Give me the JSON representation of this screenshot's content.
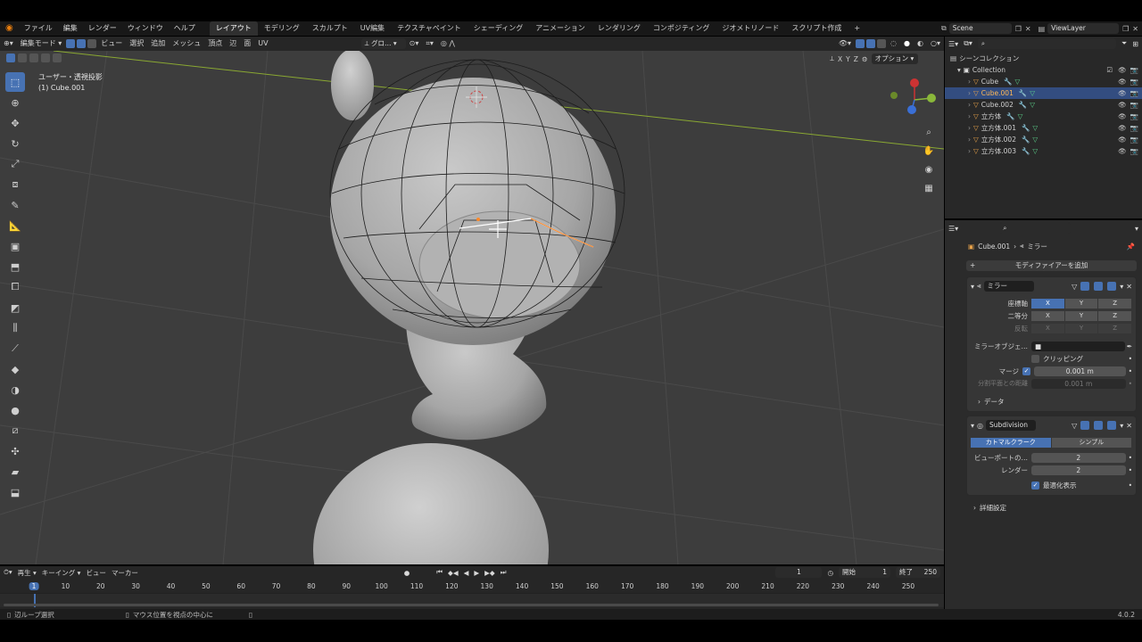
{
  "menubar": {
    "items": [
      "ファイル",
      "編集",
      "レンダー",
      "ウィンドウ",
      "ヘルプ"
    ],
    "workspaces": [
      "レイアウト",
      "モデリング",
      "スカルプト",
      "UV編集",
      "テクスチャペイント",
      "シェーディング",
      "アニメーション",
      "レンダリング",
      "コンポジティング",
      "ジオメトリノード",
      "スクリプト作成"
    ],
    "active_workspace": 0,
    "scene": "Scene",
    "viewlayer": "ViewLayer",
    "add_tab": "+"
  },
  "vp_header": {
    "mode": "編集モード",
    "menus": [
      "ビュー",
      "選択",
      "追加",
      "メッシュ",
      "頂点",
      "辺",
      "面",
      "UV"
    ],
    "orientation": "グロ…",
    "options": "オプション",
    "axes": [
      "X",
      "Y",
      "Z"
    ]
  },
  "viewport": {
    "view_label": "ユーザー・透視投影",
    "object_label": "(1) Cube.001"
  },
  "outliner": {
    "search_placeholder": "",
    "scene_collection": "シーンコレクション",
    "collection": "Collection",
    "objects": [
      {
        "name": "Cube",
        "selected": false
      },
      {
        "name": "Cube.001",
        "selected": true
      },
      {
        "name": "Cube.002",
        "selected": false
      },
      {
        "name": "立方体",
        "selected": false
      },
      {
        "name": "立方体.001",
        "selected": false
      },
      {
        "name": "立方体.002",
        "selected": false
      },
      {
        "name": "立方体.003",
        "selected": false
      }
    ]
  },
  "properties": {
    "breadcrumb_object": "Cube.001",
    "breadcrumb_modifier": "ミラー",
    "add_modifier": "モディファイアーを追加",
    "mirror": {
      "name": "ミラー",
      "axis_label": "座標軸",
      "bisect_label": "二等分",
      "flip_label": "反転",
      "xyz": [
        "X",
        "Y",
        "Z"
      ],
      "mirror_object_label": "ミラーオブジェ…",
      "clipping_label": "クリッピング",
      "merge_label": "マージ",
      "merge_value": "0.001 m",
      "bisect_distance_label": "分割平面との距離",
      "bisect_distance_value": "0.001 m",
      "data_label": "データ"
    },
    "subdivision": {
      "name": "Subdivision",
      "catmull": "カトマルクラーク",
      "simple": "シンプル",
      "viewport_label": "ビューポートの…",
      "viewport_value": "2",
      "render_label": "レンダー",
      "render_value": "2",
      "optimal_label": "最適化表示",
      "advanced_label": "詳細設定"
    }
  },
  "timeline": {
    "menus": [
      "再生",
      "キーイング",
      "ビュー",
      "マーカー"
    ],
    "current_frame": "1",
    "start_label": "開始",
    "start_value": "1",
    "end_label": "終了",
    "end_value": "250",
    "ticks": [
      "1",
      "10",
      "20",
      "30",
      "40",
      "50",
      "60",
      "70",
      "80",
      "90",
      "100",
      "110",
      "120",
      "130",
      "140",
      "150",
      "160",
      "170",
      "180",
      "190",
      "200",
      "210",
      "220",
      "230",
      "240",
      "250"
    ]
  },
  "statusbar": {
    "left": "辺ループ選択",
    "middle": "マウス位置を視点の中心に",
    "version": "4.0.2"
  },
  "colors": {
    "accent": "#4772b3",
    "selected_row": "#334d80",
    "viewport_bg": "#3d3d3d",
    "edge_select": "#ff8a2a"
  }
}
